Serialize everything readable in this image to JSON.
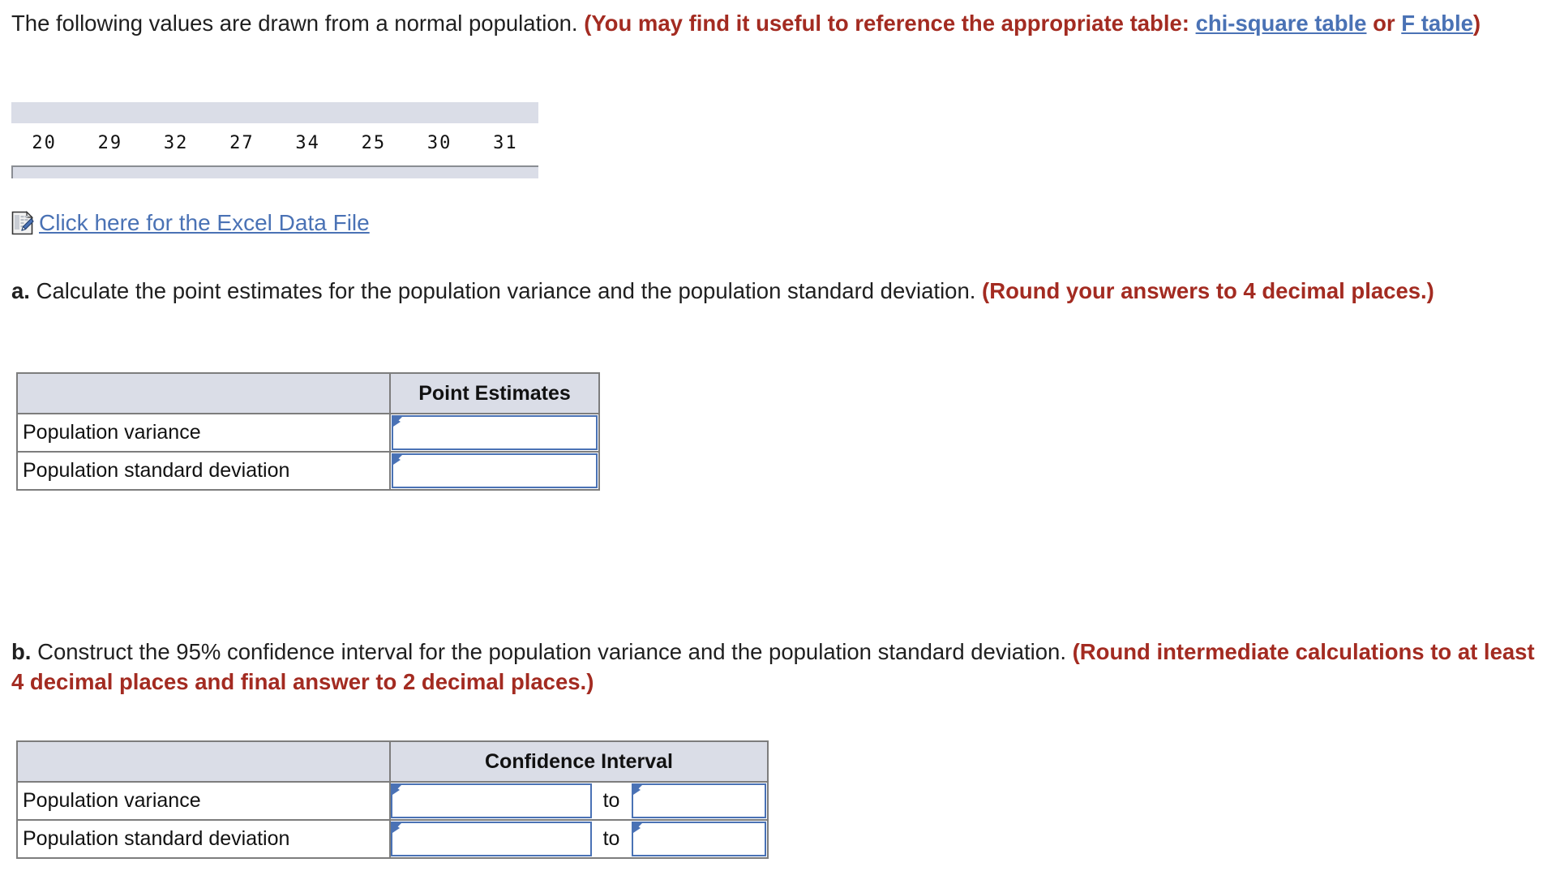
{
  "prompt": {
    "lead": "The following values are drawn from a normal population.",
    "note_open": "(You may find it useful to reference the appropriate table: ",
    "link_chi": "chi-square table",
    "note_mid": " or ",
    "link_f": "F table",
    "note_close": ")"
  },
  "data_table": {
    "values": [
      "20",
      "29",
      "32",
      "27",
      "34",
      "25",
      "30",
      "31"
    ]
  },
  "excel": {
    "icon": "excel-document-icon",
    "link_label": "Click here for the Excel Data File"
  },
  "part_a": {
    "letter": "a.",
    "question": " Calculate the point estimates for the population variance and the population standard deviation. ",
    "instruction": "(Round your answers to 4 decimal places.)",
    "table": {
      "col_blank_header": "",
      "col_value_header": "Point Estimates",
      "rows": [
        {
          "label": "Population variance",
          "value": ""
        },
        {
          "label": "Population standard deviation",
          "value": ""
        }
      ]
    }
  },
  "part_b": {
    "letter": "b.",
    "question": " Construct the 95% confidence interval for the population variance and the population standard deviation. ",
    "instruction": "(Round intermediate calculations to at least 4 decimal places and final answer to 2 decimal places.)",
    "table": {
      "col_blank_header": "",
      "col_value_header": "Confidence Interval",
      "separator": "to",
      "rows": [
        {
          "label": "Population variance",
          "lower": "",
          "separator": "to",
          "upper": ""
        },
        {
          "label": "Population standard deviation",
          "lower": "",
          "separator": "to",
          "upper": ""
        }
      ]
    }
  },
  "colors": {
    "red": "#a32b21",
    "link_blue": "#4a72b5",
    "header_bg": "#dadde7",
    "border_grey": "#7d7d7d",
    "input_border": "#4a72b5"
  }
}
